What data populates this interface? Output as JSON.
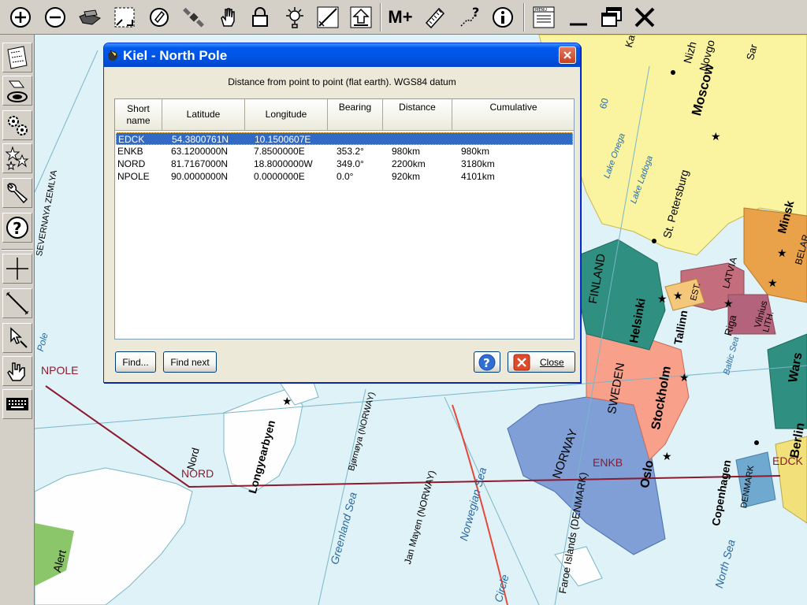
{
  "toolbar": {
    "buttons": [
      {
        "name": "zoom-in-icon"
      },
      {
        "name": "zoom-out-icon"
      },
      {
        "name": "flyover-icon"
      },
      {
        "name": "fit-window-icon"
      },
      {
        "name": "rotate-map-icon"
      },
      {
        "name": "satellite-icon"
      },
      {
        "name": "pan-hand-icon"
      },
      {
        "name": "lock-icon"
      },
      {
        "name": "brightness-icon"
      },
      {
        "name": "draw-icon"
      },
      {
        "name": "upload-icon"
      },
      {
        "name": "memory-plus-icon",
        "label": "M+"
      },
      {
        "name": "ruler-icon"
      },
      {
        "name": "route-query-icon"
      },
      {
        "name": "info-icon"
      },
      {
        "name": "menu-icon",
        "label": "MENU"
      },
      {
        "name": "minimize-icon"
      },
      {
        "name": "restore-icon"
      },
      {
        "name": "close-icon"
      }
    ]
  },
  "left_toolbar": {
    "buttons": [
      {
        "name": "map-icon"
      },
      {
        "name": "target-icon"
      },
      {
        "name": "gears-icon"
      },
      {
        "name": "stars-icon"
      },
      {
        "name": "wrench-icon"
      },
      {
        "name": "help-icon"
      },
      {
        "name": "crosshair-icon"
      },
      {
        "name": "line-icon"
      },
      {
        "name": "pointer-icon"
      },
      {
        "name": "hand-pointer-icon"
      },
      {
        "name": "keyboard-icon"
      }
    ]
  },
  "map": {
    "route_labels": {
      "npole": "NPOLE",
      "nord": "NORD",
      "enkb": "ENKB",
      "edck": "EDCK"
    },
    "labels": {
      "moscow": "Moscow",
      "nizhny": "Nizh",
      "novgorod": "Novgo",
      "st_petersburg": "St. Petersburg",
      "lake_ladoga": "Lake Ladoga",
      "lake_onega": "Lake Onega",
      "minsk": "Minsk",
      "belar": "BELAR",
      "latvia": "LATVIA",
      "est": "EST.",
      "riga": "Riga",
      "vilnius": "Vilnius",
      "lith": "LITH.",
      "finland": "FINLAND",
      "helsinki": "Helsinki",
      "tallinn": "Tallinn",
      "sweden": "SWEDEN",
      "stockholm": "Stockholm",
      "baltic_sea": "Baltic Sea",
      "warsaw": "Wars",
      "berlin": "Berlin",
      "norway": "NORWAY",
      "oslo": "Oslo",
      "copenhagen": "Copenhagen",
      "denmark": "DENMARK",
      "norwegian_sea": "Norwegian Sea",
      "greenland_sea": "Greenland Sea",
      "jan_mayen": "Jan Mayen (NORWAY)",
      "bjornoya": "Bjørnøya (NORWAY)",
      "longyearbyen": "Longyearbyen",
      "nord": "Nord",
      "alert": "Alert",
      "faroe": "Faroe Islands (DENMARK)",
      "north_sea": "North Sea",
      "arctic_circle": "Circle",
      "severnaya_zemlya": "SEVERNAYA ZEMLYA",
      "pole": "Pole",
      "degree_60": "60",
      "ka": "Ka",
      "sar": "Sar"
    }
  },
  "dialog": {
    "title": "Kiel - North Pole",
    "subtitle": "Distance from point to point (flat earth). WGS84 datum",
    "columns": {
      "short_name": [
        "Short",
        "name"
      ],
      "latitude": "Latitude",
      "longitude": "Longitude",
      "bearing": "Bearing",
      "distance": "Distance",
      "cumulative": "Cumulative"
    },
    "rows": [
      {
        "name": "EDCK",
        "lat": "54.3800761N",
        "lon": "10.1500607E",
        "bearing": "",
        "distance": "",
        "cumulative": "",
        "selected": true
      },
      {
        "name": "ENKB",
        "lat": "63.1200000N",
        "lon": "7.8500000E",
        "bearing": "353.2°",
        "distance": "980km",
        "cumulative": "980km",
        "selected": false
      },
      {
        "name": "NORD",
        "lat": "81.7167000N",
        "lon": "18.8000000W",
        "bearing": "349.0°",
        "distance": "2200km",
        "cumulative": "3180km",
        "selected": false
      },
      {
        "name": "NPOLE",
        "lat": "90.0000000N",
        "lon": "0.0000000E",
        "bearing": "0.0°",
        "distance": "920km",
        "cumulative": "4101km",
        "selected": false
      }
    ],
    "buttons": {
      "find": "Find...",
      "find_next": "Find next",
      "close": "Close"
    }
  }
}
